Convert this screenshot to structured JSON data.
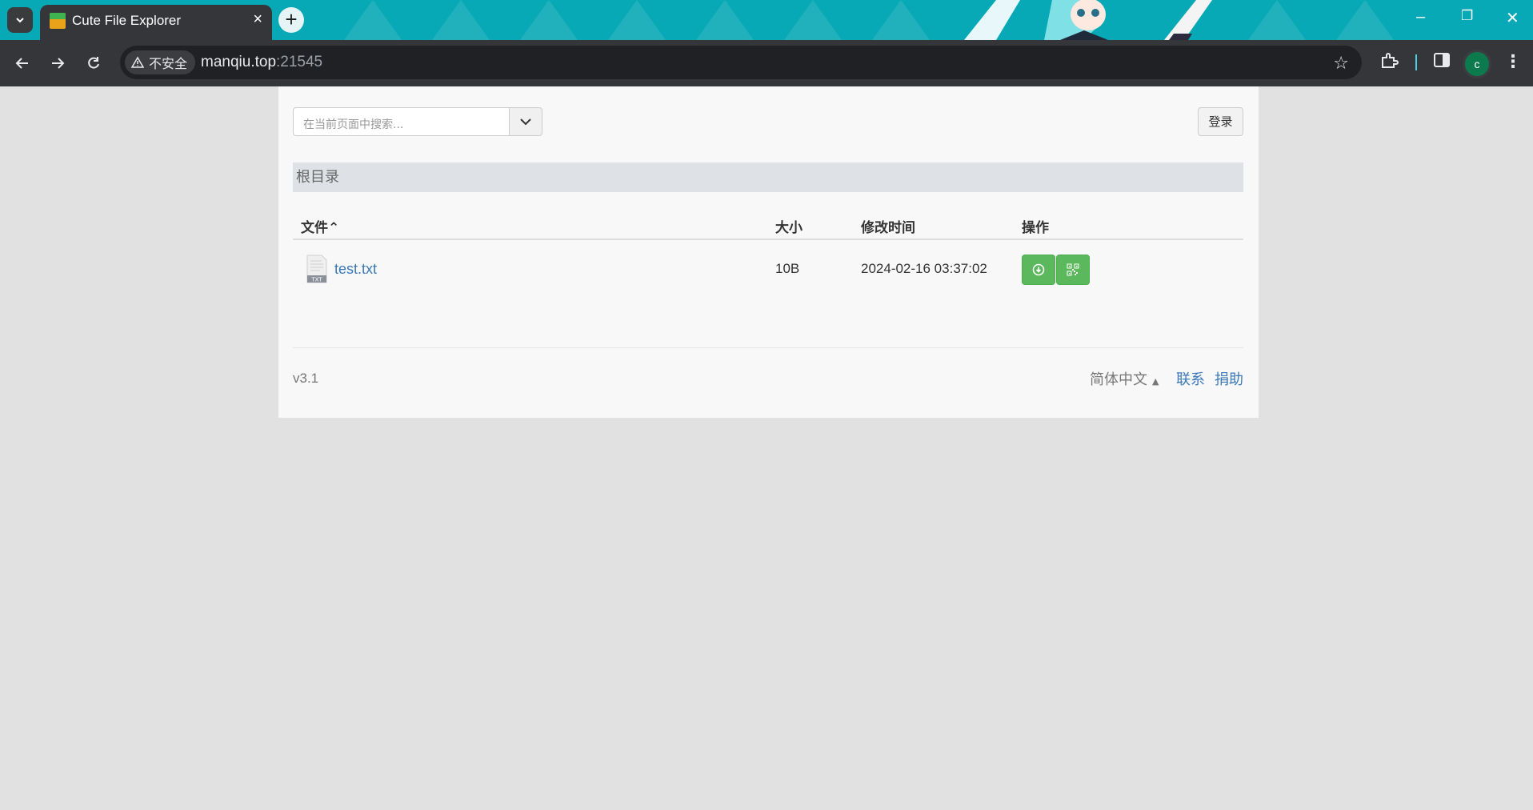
{
  "browser": {
    "tab_title": "Cute File Explorer",
    "insecure_label": "不安全",
    "url_host": "manqiu.top",
    "url_port": ":21545",
    "profile_initial": "c"
  },
  "page": {
    "search_placeholder": "在当前页面中搜索...",
    "login_label": "登录",
    "breadcrumb": "根目录",
    "columns": {
      "file": "文件",
      "sort_indicator": "⌃",
      "size": "大小",
      "mtime": "修改时间",
      "actions": "操作"
    },
    "files": [
      {
        "name": "test.txt",
        "type_badge": "TXT",
        "size": "10B",
        "mtime": "2024-02-16 03:37:02"
      }
    ],
    "footer": {
      "version": "v3.1",
      "language": "简体中文",
      "contact": "联系",
      "donate": "捐助"
    }
  },
  "colors": {
    "titlebar": "#08a9b6",
    "toolbar": "#35363a",
    "action_green": "#5cb85c",
    "link_blue": "#3a78b8"
  }
}
